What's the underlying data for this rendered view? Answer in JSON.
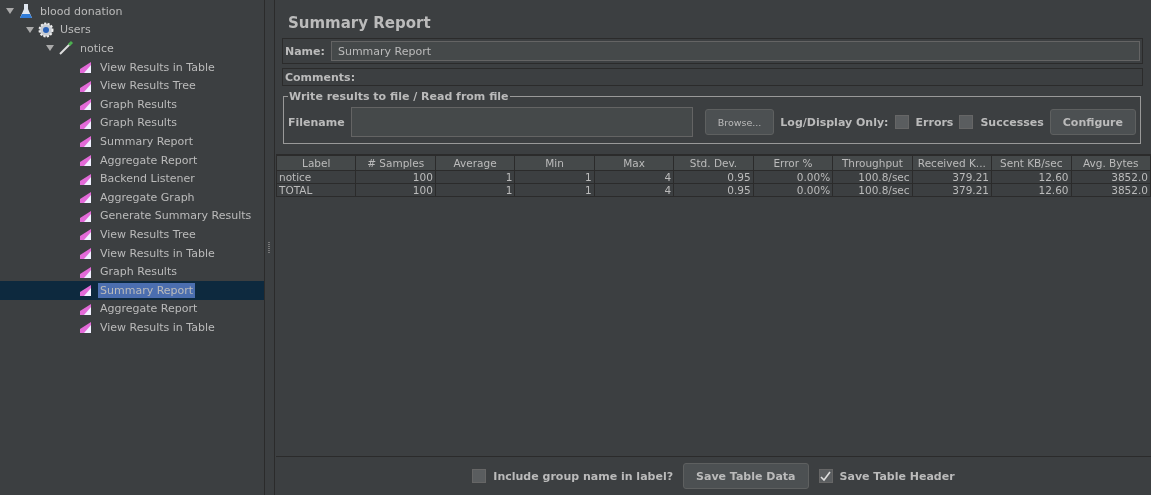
{
  "tree": [
    {
      "label": "blood donation",
      "kind": "plan",
      "expanded": true,
      "selected": false,
      "children": [
        {
          "label": "Users",
          "kind": "group",
          "expanded": true,
          "selected": false,
          "children": [
            {
              "label": "notice",
              "kind": "sampler",
              "expanded": true,
              "selected": false,
              "children": [
                {
                  "label": "View Results in Table",
                  "kind": "listener",
                  "selected": false
                },
                {
                  "label": "View Results Tree",
                  "kind": "listener",
                  "selected": false
                },
                {
                  "label": "Graph Results",
                  "kind": "listener",
                  "selected": false
                },
                {
                  "label": "Graph Results",
                  "kind": "listener",
                  "selected": false
                },
                {
                  "label": "Summary Report",
                  "kind": "listener",
                  "selected": false
                },
                {
                  "label": "Aggregate Report",
                  "kind": "listener",
                  "selected": false
                },
                {
                  "label": "Backend Listener",
                  "kind": "listener",
                  "selected": false
                },
                {
                  "label": "Aggregate Graph",
                  "kind": "listener",
                  "selected": false
                },
                {
                  "label": "Generate Summary Results",
                  "kind": "listener",
                  "selected": false
                },
                {
                  "label": "View Results Tree",
                  "kind": "listener",
                  "selected": false
                },
                {
                  "label": "View Results in Table",
                  "kind": "listener",
                  "selected": false
                },
                {
                  "label": "Graph Results",
                  "kind": "listener",
                  "selected": false
                },
                {
                  "label": "Summary Report",
                  "kind": "listener",
                  "selected": true
                },
                {
                  "label": "Aggregate Report",
                  "kind": "listener",
                  "selected": false
                },
                {
                  "label": "View Results in Table",
                  "kind": "listener",
                  "selected": false
                }
              ]
            }
          ]
        }
      ]
    }
  ],
  "panel": {
    "title": "Summary Report",
    "name_label": "Name:",
    "name_value": "Summary Report",
    "comments_label": "Comments:",
    "file_group": {
      "legend": "Write results to file / Read from file",
      "filename_label": "Filename",
      "browse": "Browse...",
      "log_label": "Log/Display Only:",
      "errors": {
        "label": "Errors",
        "checked": false
      },
      "successes": {
        "label": "Successes",
        "checked": false
      },
      "configure": "Configure"
    }
  },
  "table": {
    "columns": [
      "Label",
      "# Samples",
      "Average",
      "Min",
      "Max",
      "Std. Dev.",
      "Error %",
      "Throughput",
      "Received K...",
      "Sent KB/sec",
      "Avg. Bytes"
    ],
    "rows": [
      [
        "notice",
        "100",
        "1",
        "1",
        "4",
        "0.95",
        "0.00%",
        "100.8/sec",
        "379.21",
        "12.60",
        "3852.0"
      ],
      [
        "TOTAL",
        "100",
        "1",
        "1",
        "4",
        "0.95",
        "0.00%",
        "100.8/sec",
        "379.21",
        "12.60",
        "3852.0"
      ]
    ]
  },
  "footer": {
    "include_group": {
      "label": "Include group name in label?",
      "checked": false
    },
    "save_data": "Save Table Data",
    "save_header": {
      "label": "Save Table Header",
      "checked": true
    }
  }
}
